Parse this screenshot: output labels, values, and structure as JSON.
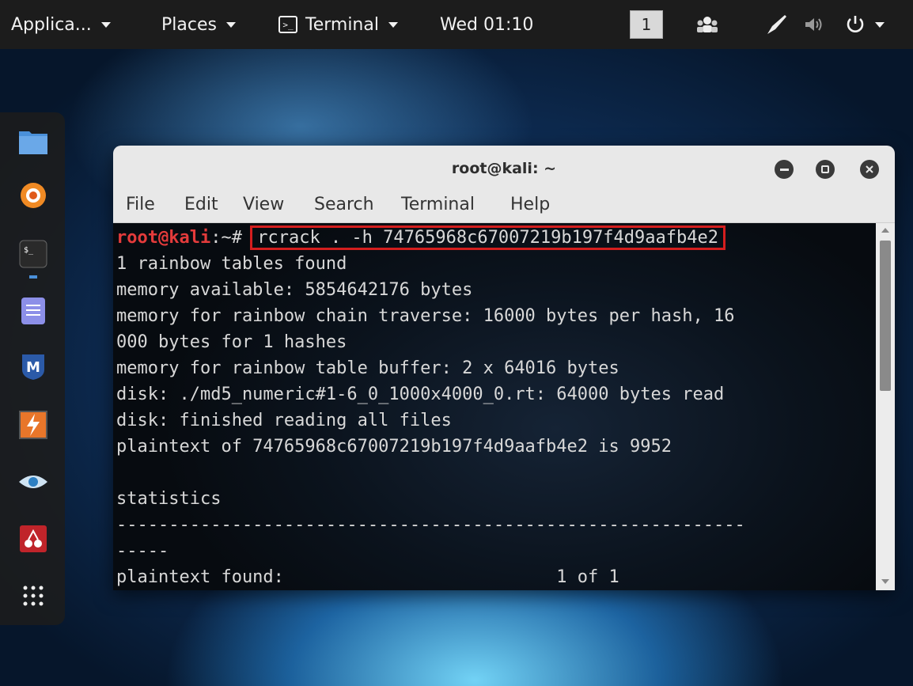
{
  "topbar": {
    "applications": "Applica...",
    "places": "Places",
    "app_menu": "Terminal",
    "clock": "Wed 01:10",
    "workspace": "1"
  },
  "dock": {
    "items": [
      "files-icon",
      "firefox-icon",
      "terminal-icon",
      "text-editor-icon",
      "metasploit-icon",
      "burpsuite-icon",
      "zenmap-icon",
      "cherrytree-icon",
      "show-apps-icon"
    ]
  },
  "window": {
    "title": "root@kali: ~",
    "menu": [
      "File",
      "Edit",
      "View",
      "Search",
      "Terminal",
      "Help"
    ]
  },
  "terminal": {
    "prompt_user": "root@kali",
    "prompt_path": ":~#",
    "command": "rcrack . -h 74765968c67007219b197f4d9aafb4e2",
    "lines": [
      "1 rainbow tables found",
      "memory available: 5854642176 bytes",
      "memory for rainbow chain traverse: 16000 bytes per hash, 16",
      "000 bytes for 1 hashes",
      "memory for rainbow table buffer: 2 x 64016 bytes",
      "disk: ./md5_numeric#1-6_0_1000x4000_0.rt: 64000 bytes read",
      "disk: finished reading all files",
      "plaintext of 74765968c67007219b197f4d9aafb4e2 is 9952",
      "",
      "statistics",
      "------------------------------------------------------------",
      "-----",
      "plaintext found:                          1 of 1"
    ]
  },
  "colors": {
    "prompt": "#e43b3b",
    "highlight": "#d41e1e",
    "topbar": "#1c1c1c"
  }
}
